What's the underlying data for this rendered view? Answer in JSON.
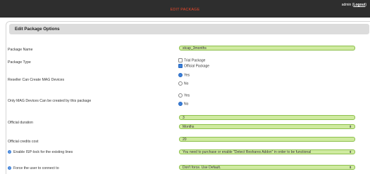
{
  "header": {
    "title": "EDIT PACKAGE",
    "user_text": "admin (",
    "logout_label": "Logout",
    "user_close": ")",
    "accent": "#e8482b"
  },
  "panel": {
    "title": "Edit Package Options"
  },
  "form": {
    "package_name": {
      "label": "Package Name",
      "value": "stcap_3months"
    },
    "package_type": {
      "label": "Package Type",
      "options": [
        {
          "label": "Trial Package",
          "checked": false
        },
        {
          "label": "Official Package",
          "checked": true
        }
      ]
    },
    "reseller_mag": {
      "label": "Reseller Can Create MAG Devices",
      "yes": "Yes",
      "no": "No",
      "selected": "Yes"
    },
    "only_mag": {
      "label": "Only MAG Devices Can be created by this package",
      "yes": "Yes",
      "no": "No",
      "selected": "No"
    },
    "official_duration": {
      "label": "Official duration",
      "value": "3",
      "unit": "Months"
    },
    "official_credits": {
      "label": "Official credits cost",
      "value": "20"
    },
    "isp_lock": {
      "label": "Enable ISP-lock for the existing lines",
      "value": "You need to purchase or enable \"Detect Reshares Addon\" in order to be functional"
    },
    "force_connect": {
      "label": "Force the user to connect to",
      "value": "Don't force. Use Default."
    }
  }
}
